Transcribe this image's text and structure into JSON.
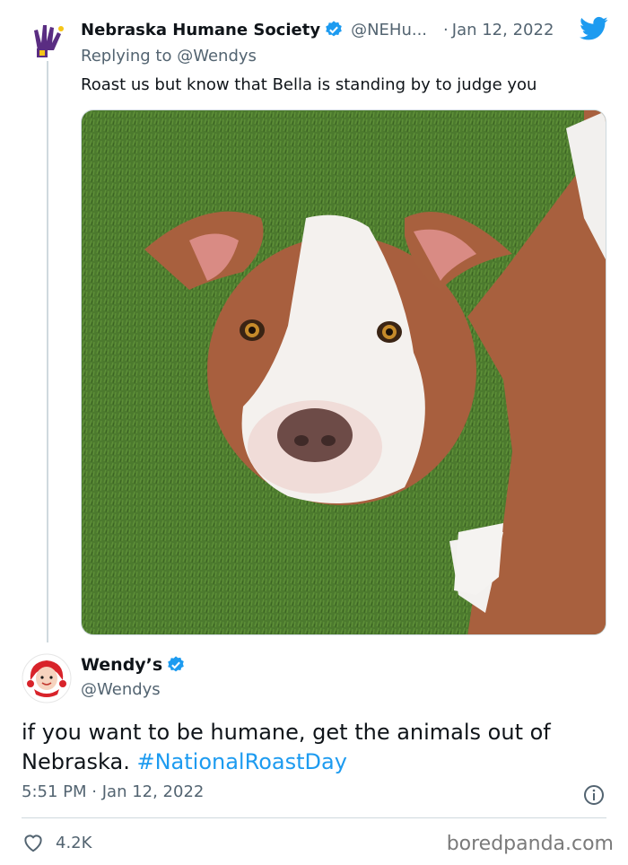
{
  "reply_tweet": {
    "author_name": "Nebraska Humane Society",
    "handle": "@NEHu...",
    "date_sep": "·",
    "date": "Jan 12, 2022",
    "replying_to_prefix": "Replying to",
    "replying_to_handle": "@Wendys",
    "text": "Roast us but know that Bella is standing by to judge you",
    "avatar_icon": "nhs-hand-logo-icon",
    "image_alt": "dog photo"
  },
  "main_tweet": {
    "author_name": "Wendy’s",
    "handle": "@Wendys",
    "text": "if you want to be humane, get the animals out of Nebraska.",
    "hashtag": "#NationalRoastDay",
    "time": "5:51 PM",
    "date_sep": "·",
    "date": "Jan 12, 2022",
    "likes": "4.2K",
    "avatar_icon": "wendys-logo-icon"
  },
  "watermark": "boredpanda.com",
  "colors": {
    "link": "#1d9bf0",
    "secondary_text": "#536471",
    "verified": "#1d9bf0",
    "twitter_bird": "#1d9bf0",
    "nhs_purple": "#5a2d82"
  }
}
